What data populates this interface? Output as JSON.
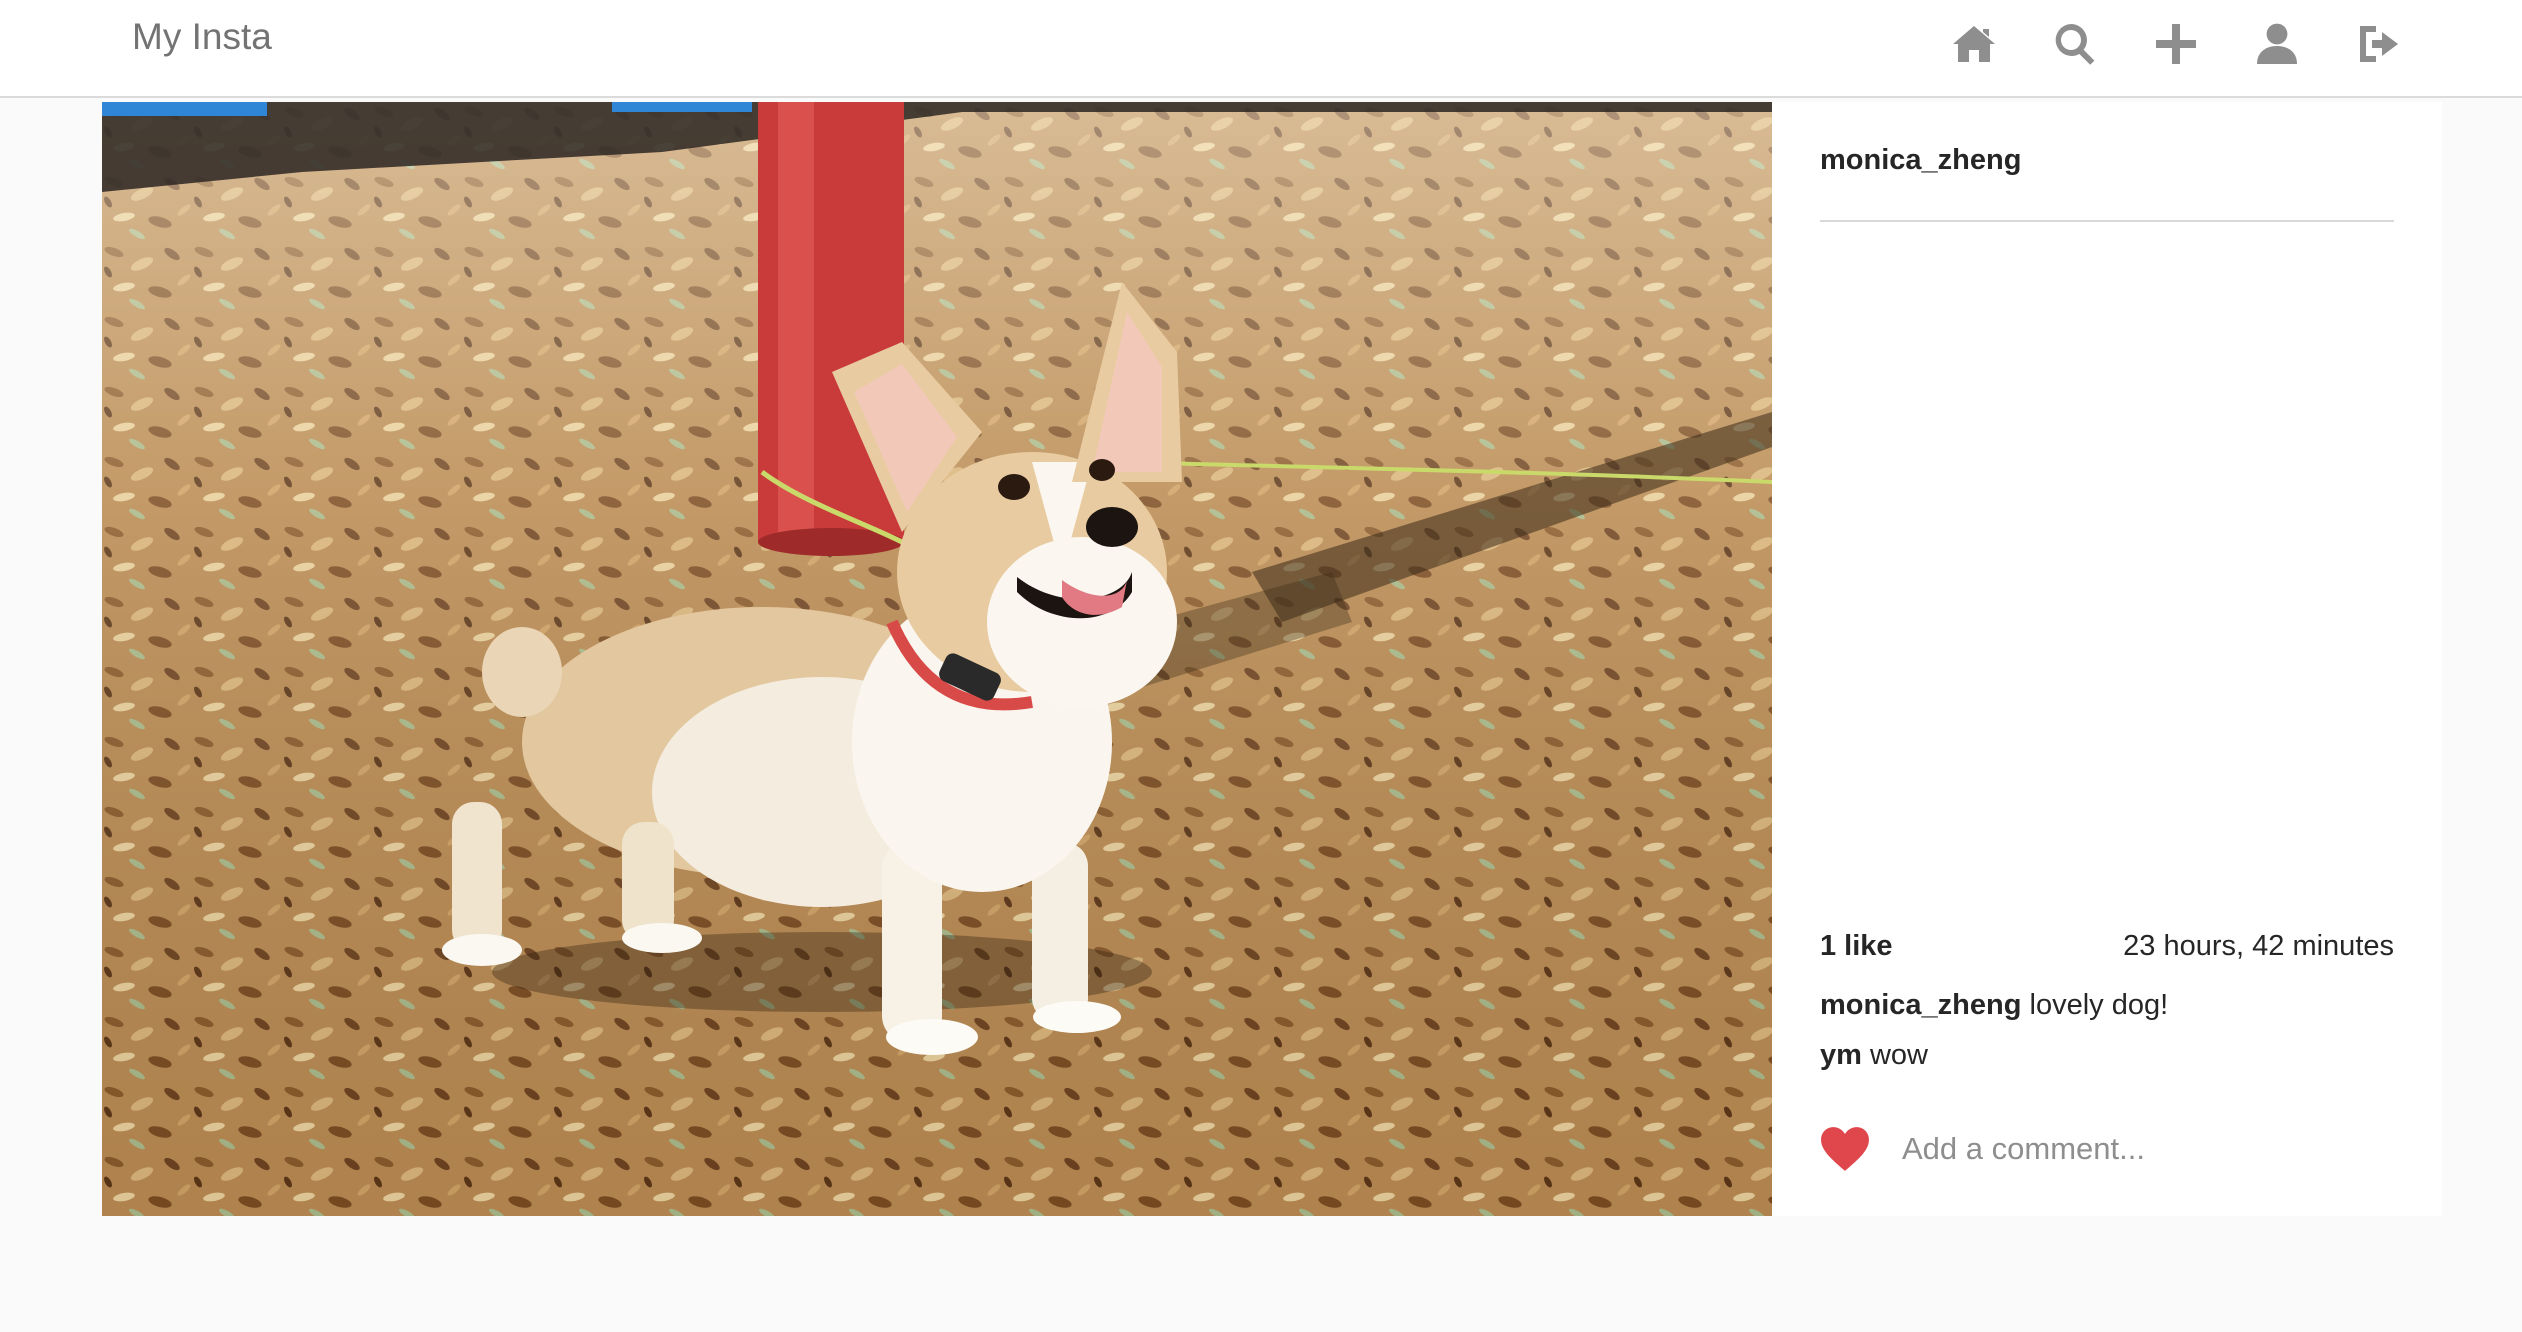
{
  "header": {
    "brand": "My Insta",
    "nav": [
      {
        "name": "home-icon"
      },
      {
        "name": "search-icon"
      },
      {
        "name": "plus-icon"
      },
      {
        "name": "user-icon"
      },
      {
        "name": "logout-icon"
      }
    ]
  },
  "post": {
    "author": "monica_zheng",
    "likes": "1 like",
    "age": "23 hours, 42 minutes",
    "comments": [
      {
        "user": "monica_zheng",
        "text": "lovely dog!"
      },
      {
        "user": "ym",
        "text": "wow"
      }
    ],
    "comment_placeholder": "Add a comment..."
  },
  "colors": {
    "heart": "#e0474c",
    "icon": "#8e8e8e"
  }
}
